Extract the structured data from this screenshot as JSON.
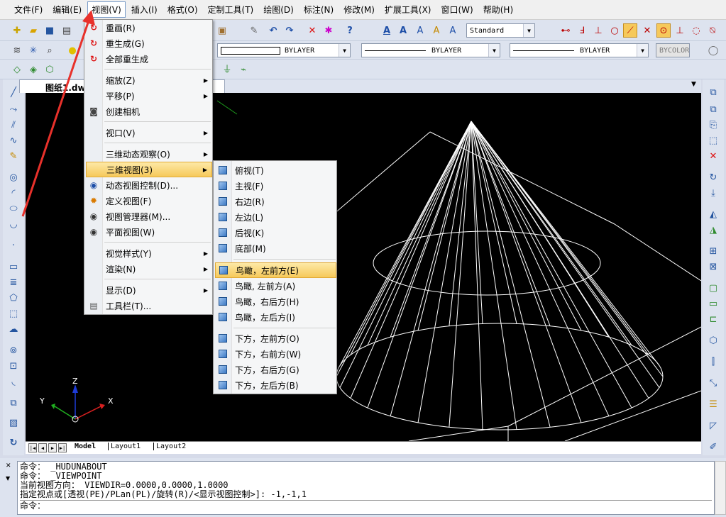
{
  "menubar": {
    "items": [
      {
        "label": "文件(F)"
      },
      {
        "label": "编辑(E)"
      },
      {
        "label": "视图(V)"
      },
      {
        "label": "插入(I)"
      },
      {
        "label": "格式(O)"
      },
      {
        "label": "定制工具(T)"
      },
      {
        "label": "绘图(D)"
      },
      {
        "label": "标注(N)"
      },
      {
        "label": "修改(M)"
      },
      {
        "label": "扩展工具(X)"
      },
      {
        "label": "窗口(W)"
      },
      {
        "label": "帮助(H)"
      }
    ]
  },
  "toolbar": {
    "text_style": "Standard",
    "layer_color": "BYLAYER",
    "linetype": "BYLAYER",
    "lineweight": "BYLAYER",
    "plot_style": "BYCOLOR"
  },
  "document": {
    "tab_label": "图纸1.dwg"
  },
  "view_menu": {
    "items": [
      {
        "label": "重画(R)",
        "icon": "redraw-icon"
      },
      {
        "label": "重生成(G)",
        "icon": "regen-icon"
      },
      {
        "label": "全部重生成",
        "icon": "regen-all-icon"
      },
      {
        "label": "缩放(Z)"
      },
      {
        "label": "平移(P)"
      },
      {
        "label": "创建相机",
        "icon": "camera-icon"
      },
      {
        "label": "视口(V)"
      },
      {
        "label": "三维动态观察(O)"
      },
      {
        "label": "三维视图(3)"
      },
      {
        "label": "动态视图控制(D)...",
        "icon": "dynamic-view-icon"
      },
      {
        "label": "定义视图(F)",
        "icon": "define-view-icon"
      },
      {
        "label": "视图管理器(M)...",
        "icon": "view-manager-icon"
      },
      {
        "label": "平面视图(W)",
        "icon": "plan-view-icon"
      },
      {
        "label": "视觉样式(Y)"
      },
      {
        "label": "渲染(N)"
      },
      {
        "label": "显示(D)"
      },
      {
        "label": "工具栏(T)...",
        "icon": "toolbar-icon"
      }
    ]
  },
  "view3d_submenu": {
    "items": [
      {
        "label": "俯视(T)"
      },
      {
        "label": "主视(F)"
      },
      {
        "label": "右边(R)"
      },
      {
        "label": "左边(L)"
      },
      {
        "label": "后视(K)"
      },
      {
        "label": "底部(M)"
      },
      {
        "label": "鸟瞰，左前方(E)"
      },
      {
        "label": "鸟瞰, 左前方(A)"
      },
      {
        "label": "鸟瞰，右后方(H)"
      },
      {
        "label": "鸟瞰，左后方(I)"
      },
      {
        "label": "下方，左前方(O)"
      },
      {
        "label": "下方，右前方(W)"
      },
      {
        "label": "下方，右后方(G)"
      },
      {
        "label": "下方，左后方(B)"
      }
    ]
  },
  "ucs": {
    "x": "X",
    "y": "Y",
    "z": "Z"
  },
  "layout_tabs": [
    "Model",
    "Layout1",
    "Layout2"
  ],
  "command_line": {
    "lines": [
      "命令： _HUDUNABOUT",
      "命令： _VIEWPOINT",
      "当前视图方向： VIEWDIR=0.0000,0.0000,1.0000",
      "指定视点或[透视(PE)/PLan(PL)/旋转(R)/<显示视图控制>]: -1,-1,1"
    ],
    "prompt": "命令："
  },
  "colors": {
    "accent": "#e8312b",
    "highlight": "#f6c95b",
    "canvas": "#000000"
  }
}
